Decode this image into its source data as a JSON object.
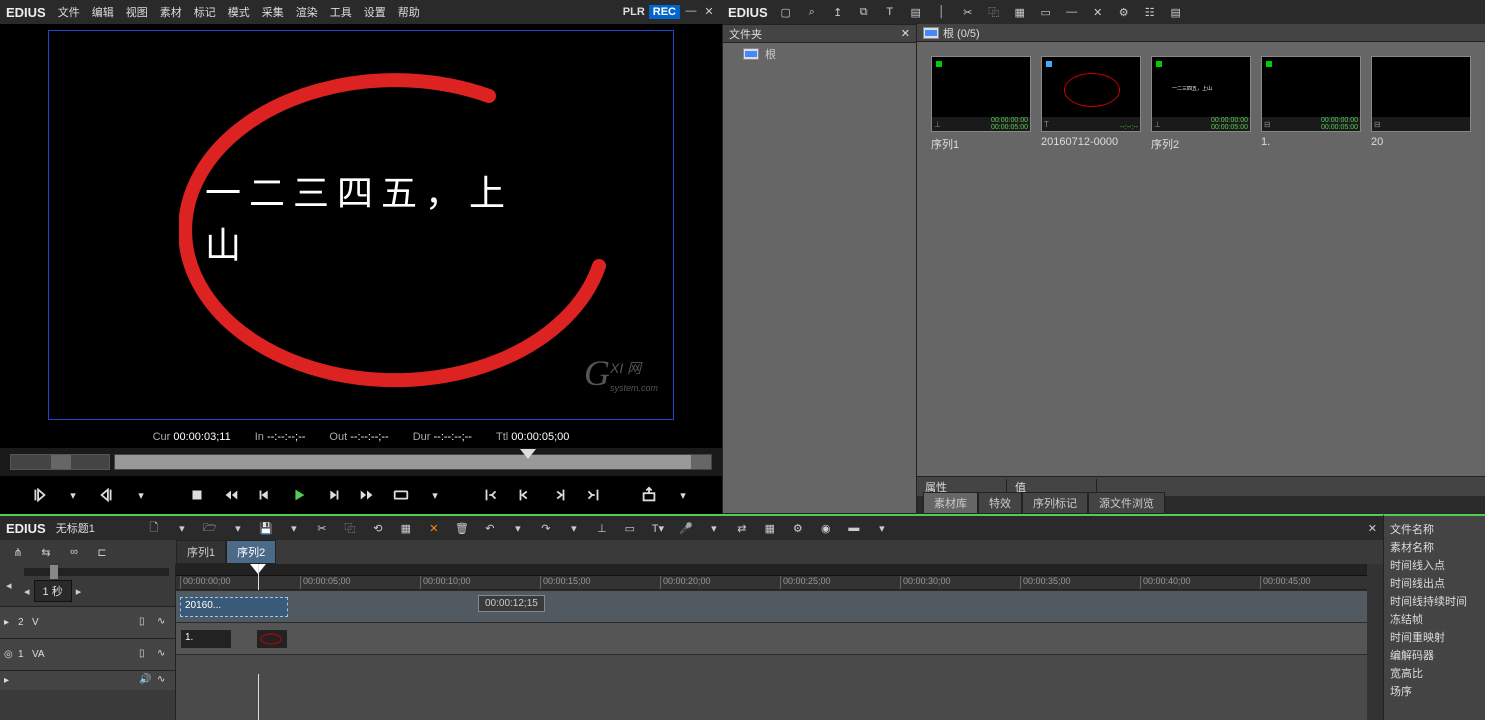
{
  "app_name": "EDIUS",
  "menubar": [
    "文件",
    "编辑",
    "视图",
    "素材",
    "标记",
    "模式",
    "采集",
    "渲染",
    "工具",
    "设置",
    "帮助"
  ],
  "mode_labels": {
    "plr": "PLR",
    "rec": "REC"
  },
  "preview": {
    "text": "一二三四五，上山",
    "watermark_main": "G",
    "watermark_sub": "XI 网",
    "watermark_small": "system.com"
  },
  "timecode": {
    "cur_label": "Cur",
    "cur_value": "00:00:03;11",
    "in_label": "In",
    "in_value": "--:--:--;--",
    "out_label": "Out",
    "out_value": "--:--:--;--",
    "dur_label": "Dur",
    "dur_value": "--:--:--;--",
    "ttl_label": "Ttl",
    "ttl_value": "00:00:05;00"
  },
  "bin": {
    "folder_panel_title": "文件夹",
    "root_folder": "根",
    "thumbs_title": "根 (0/5)",
    "items": [
      {
        "label": "序列1",
        "tc1": "00:00:00:00",
        "tc2": "00:00:05:00",
        "dot": "green",
        "type": "seq"
      },
      {
        "label": "20160712-0000",
        "tc1": "",
        "tc2": "--:--:--",
        "dot": "blue",
        "type": "title",
        "oval": true
      },
      {
        "label": "序列2",
        "tc1": "00:00:00:00",
        "tc2": "00:00:05:00",
        "dot": "green",
        "type": "seq",
        "text": "一二三四五，上山"
      },
      {
        "label": "1.",
        "tc1": "00:00:00:00",
        "tc2": "00:00:05:00",
        "dot": "green",
        "type": "clip"
      },
      {
        "label": "20",
        "tc1": "",
        "tc2": "",
        "dot": "",
        "type": "clip"
      }
    ],
    "prop_attr": "属性",
    "prop_val": "值",
    "tabs": [
      "素材库",
      "特效",
      "序列标记",
      "源文件浏览"
    ]
  },
  "timeline": {
    "title": "无标题1",
    "seq_tabs": [
      "序列1",
      "序列2"
    ],
    "seq_active": 1,
    "scale_label": "1 秒",
    "ruler": [
      "00:00:00;00",
      "00:00:05;00",
      "00:00:10;00",
      "00:00:15;00",
      "00:00:20;00",
      "00:00:25;00",
      "00:00:30;00",
      "00:00:35;00",
      "00:00:40;00",
      "00:00:45;00"
    ],
    "tracks": [
      {
        "num": "2",
        "type": "V"
      },
      {
        "num": "1",
        "type": "VA"
      }
    ],
    "clips": {
      "v2_clip": "20160...",
      "va1_clip": "1."
    },
    "tooltip": "00:00:12;15"
  },
  "info_panel": [
    "文件名称",
    "素材名称",
    "时间线入点",
    "时间线出点",
    "时间线持续时间",
    "冻结帧",
    "时间重映射",
    "编解码器",
    "宽高比",
    "场序"
  ]
}
